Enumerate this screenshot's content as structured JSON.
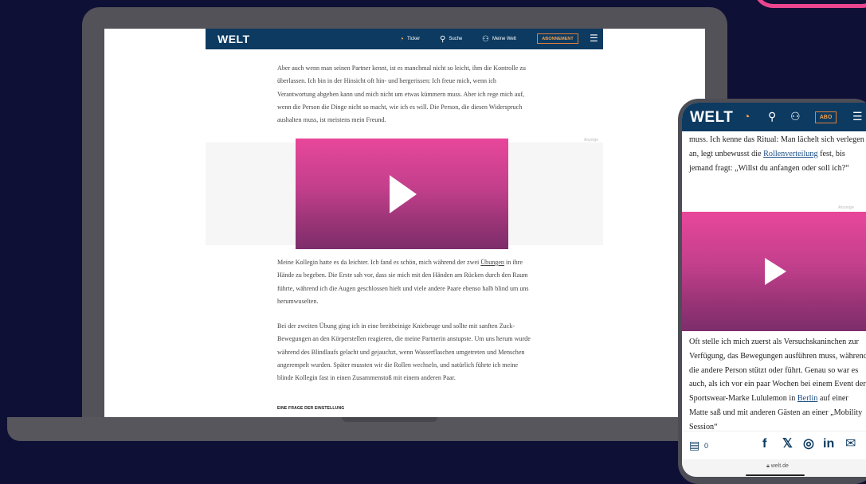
{
  "colors": {
    "background": "#0f1036",
    "accent_pink": "#e9468f",
    "welt_blue": "#0c3a61",
    "abo_orange": "#f1a24c"
  },
  "desktop": {
    "logo": "WELT",
    "nav": [
      {
        "icon": "ticker-icon",
        "label": "Ticker"
      },
      {
        "icon": "search-icon",
        "label": "Suche"
      },
      {
        "icon": "user-icon",
        "label": "Meine Welt"
      }
    ],
    "subscribe_label": "ABONNEMENT",
    "paragraph1": "Aber auch wenn man seinen Partner kennt, ist es manchmal nicht so leicht, ihm die Kontrolle zu überlassen. Ich bin in der Hinsicht oft hin- und hergerissen: Ich freue mich, wenn ich Verantwortung abgeben kann und mich nicht um etwas kümmern muss. Aber ich rege mich auf, wenn die Person die Dinge nicht so macht, wie ich es will. Die Person, die diesen Widerspruch aushalten muss, ist meistens mein Freund.",
    "ad_label": "Anzeige",
    "paragraph2_before": "Meine Kollegin hatte es da leichter. Ich fand es schön, mich während der zwei ",
    "paragraph2_link": "Übungen",
    "paragraph2_after": " in ihre Hände zu begeben. Die Erste sah vor, dass sie mich mit den Händen am Rücken durch den Raum führte, während ich die Augen geschlossen hielt und viele andere Paare ebenso halb blind um uns herumwuselten.",
    "paragraph3": "Bei der zweiten Übung ging ich in eine breitbeinige Kniebeuge und sollte mit sanften Zuck-Bewegungen an den Körperstellen reagieren, die meine Partnerin anstupste. Um uns herum wurde während des Blindlaufs gelacht und gejauchzt, wenn Wasserflaschen umgetreten und Menschen angerempelt wurden. Später mussten wir die Rollen wechseln, und natürlich führte ich meine blinde Kollegin fast in einen Zusammenstoß mit einem anderen Paar.",
    "subheading": "EINE FRAGE DER EINSTELLUNG"
  },
  "mobile": {
    "logo": "WELT",
    "subscribe_label": "ABO",
    "paragraph1_before": "muss. Ich kenne das Ritual: Man lächelt sich verlegen an, legt unbewusst die ",
    "paragraph1_link": "Rollenverteilung",
    "paragraph1_after": " fest, bis jemand fragt: „Willst du anfangen oder soll ich?“",
    "ad_label": "Anzeige",
    "paragraph2_before": "Oft stelle ich mich zuerst als Versuchskaninchen zur Verfügung, das Bewegungen ausführen muss, während die andere Person stützt oder führt. Genau so war es auch, als ich vor ein paar Wochen bei einem Event der Sportswear-Marke Lululemon in ",
    "paragraph2_link": "Berlin",
    "paragraph2_after": " auf einer Matte saß und mit anderen Gästen an einer „Mobility Session“",
    "comment_count": "0",
    "url": "welt.de"
  }
}
